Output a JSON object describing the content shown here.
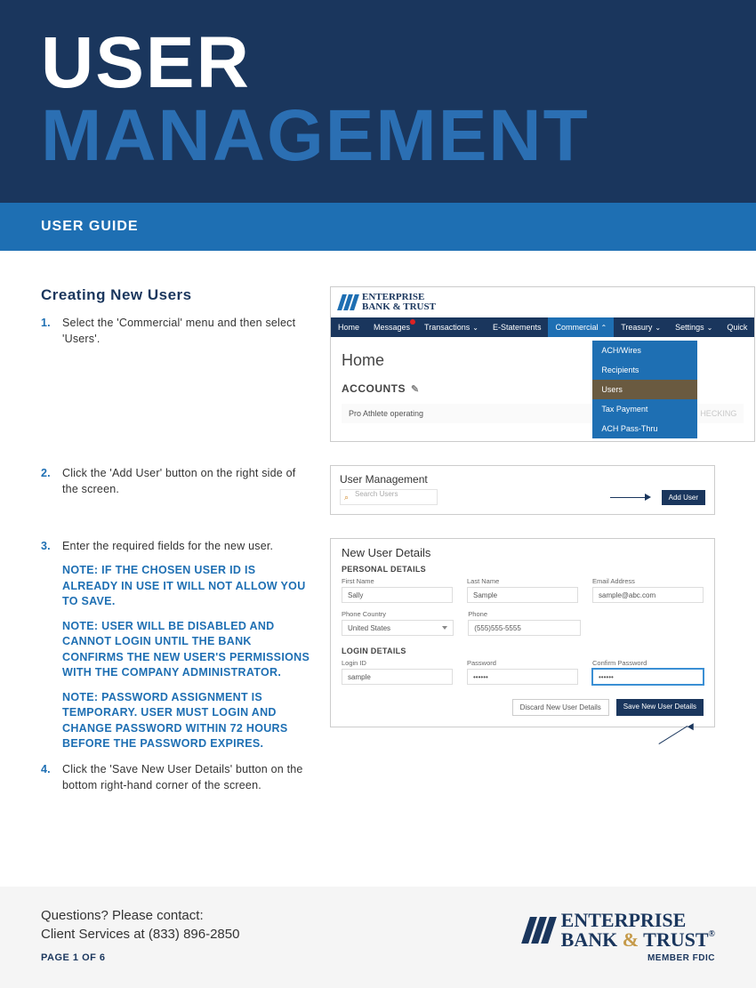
{
  "header": {
    "word1": "USER",
    "word2": "MANAGEMENT",
    "subtitle": "USER GUIDE"
  },
  "section": {
    "title": "Creating New Users",
    "steps": {
      "s1_num": "1.",
      "s1_text": "Select the 'Commercial' menu and then select 'Users'.",
      "s2_num": "2.",
      "s2_text": "Click the 'Add User' button on the right side of the screen.",
      "s3_num": "3.",
      "s3_text": "Enter the required fields for the new user.",
      "s4_num": "4.",
      "s4_text": "Click the 'Save New User Details' button on the bottom right-hand corner of the screen."
    },
    "notes": {
      "n1": "NOTE: IF THE CHOSEN USER ID IS ALREADY IN USE IT WILL NOT ALLOW YOU TO SAVE.",
      "n2": "NOTE: USER WILL BE DISABLED AND CANNOT LOGIN UNTIL THE BANK CONFIRMS THE NEW USER'S PERMISSIONS WITH THE COMPANY ADMINISTRATOR.",
      "n3": "NOTE: PASSWORD ASSIGNMENT IS TEMPORARY. USER MUST LOGIN AND CHANGE PASSWORD WITHIN 72 HOURS BEFORE THE PASSWORD EXPIRES."
    }
  },
  "panel1": {
    "brand_line1": "ENTERPRISE",
    "brand_line2": "BANK & TRUST",
    "nav": {
      "home": "Home",
      "messages": "Messages",
      "transactions": "Transactions",
      "estatements": "E-Statements",
      "commercial": "Commercial",
      "treasury": "Treasury",
      "settings": "Settings",
      "quick": "Quick"
    },
    "dropdown": {
      "d1": "ACH/Wires",
      "d2": "Recipients",
      "d3": "Users",
      "d4": "Tax Payment",
      "d5": "ACH Pass-Thru"
    },
    "home_heading": "Home",
    "accounts_label": "ACCOUNTS",
    "account_row_left": "Pro Athlete operating",
    "account_row_right": "HECKING"
  },
  "panel2": {
    "title": "User Management",
    "search_placeholder": "Search Users",
    "add_user": "Add User"
  },
  "panel3": {
    "title": "New User Details",
    "personal_header": "PERSONAL DETAILS",
    "login_header": "LOGIN DETAILS",
    "labels": {
      "first_name": "First Name",
      "last_name": "Last Name",
      "email": "Email Address",
      "phone_country": "Phone Country",
      "phone": "Phone",
      "login_id": "Login ID",
      "password": "Password",
      "confirm_password": "Confirm Password"
    },
    "values": {
      "first_name": "Sally",
      "last_name": "Sample",
      "email": "sample@abc.com",
      "phone_country": "United States",
      "phone": "(555)555-5555",
      "login_id": "sample",
      "password": "••••••",
      "confirm_password": "••••••"
    },
    "discard": "Discard New User Details",
    "save": "Save New User Details"
  },
  "footer": {
    "q1": "Questions? Please contact:",
    "q2": "Client Services at (833) 896-2850",
    "page": "PAGE 1 OF 6",
    "brand_line1": "ENTERPRISE",
    "brand_bank": "BANK",
    "brand_amp": "&",
    "brand_trust": "TRUST",
    "member": "MEMBER FDIC"
  }
}
